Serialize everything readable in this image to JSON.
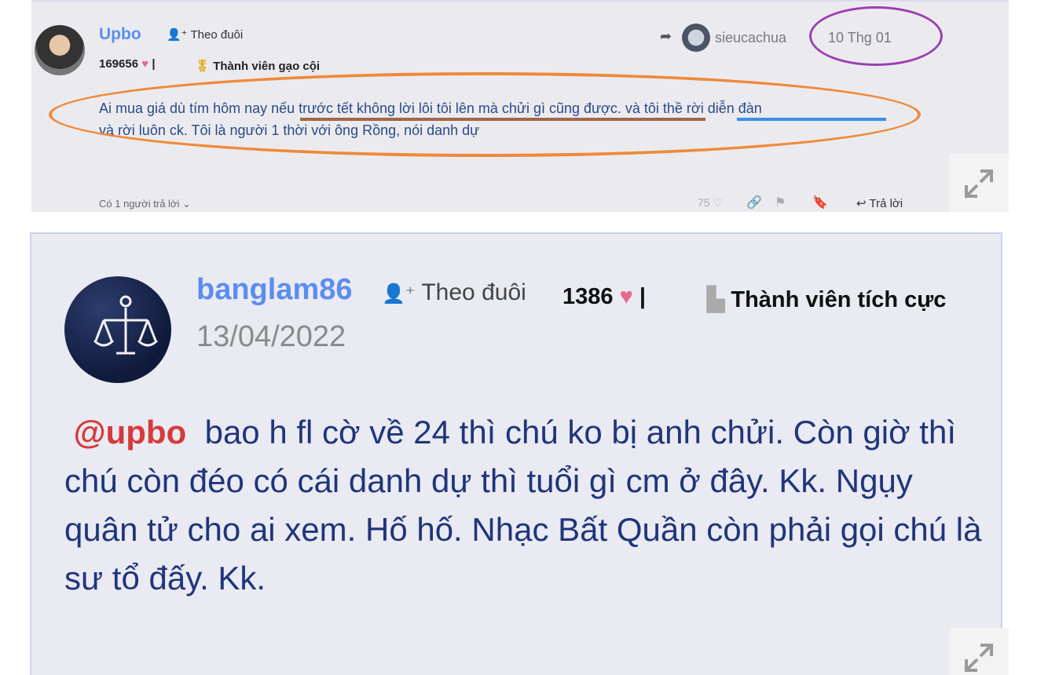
{
  "post1": {
    "username": "Upbo",
    "follow_label": "Theo đuôi",
    "score": "169656",
    "rank": "Thành viên gạo cội",
    "reply_to": "sieucachua",
    "date": "10 Thg 01",
    "body_part1": "Ai mua giá dù tím hôm nay nếu trước tết không lời lôi tôi lên mà chửi gì cũng được. và tôi thề rời diễn đàn",
    "body_part2": "và rời luôn ck. Tôi là người 1 thời với ông Rồng, nói danh dự",
    "replies_label": "Có 1 người trả lời",
    "likes": "75",
    "reply_label": "Trả lời"
  },
  "post2": {
    "username": "banglam86",
    "follow_label": "Theo đuôi",
    "score": "1386",
    "rank": "Thành viên tích cực",
    "date": "13/04/2022",
    "mention": "@upbo",
    "body": "bao h fl cờ về 24 thì chú ko bị anh chửi. Còn giờ thì chú còn đéo có cái danh dự thì tuổi gì cm ở đây. Kk. Ngụy quân tử cho ai xem. Hố hố. Nhạc Bất Quần còn phải gọi chú là sư tổ đấy. Kk."
  },
  "colors": {
    "username": "#5b8def",
    "mention": "#d63a3a",
    "body_text": "#20357a",
    "annotation_orange": "#ef8a3a",
    "annotation_purple": "#9a3fb2",
    "heart": "#e86a8c"
  }
}
